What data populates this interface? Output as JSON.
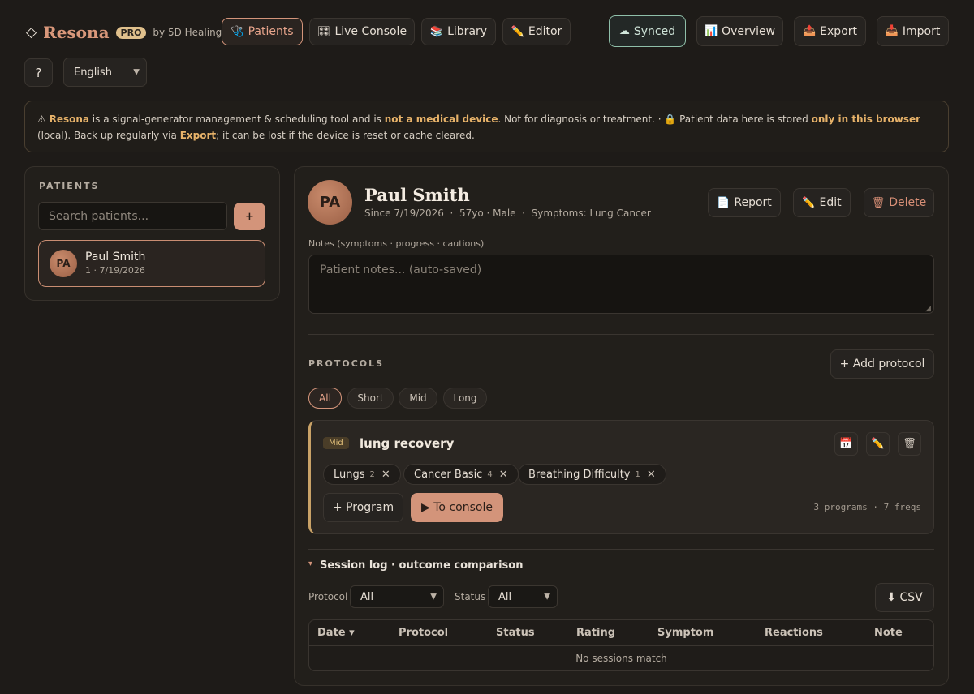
{
  "header": {
    "brand_mark": "◇",
    "brand_name": "Resona",
    "pro": "PRO",
    "by": "by 5D Healing",
    "tabs": [
      {
        "icon": "🩺",
        "label": "Patients"
      },
      {
        "icon": "🎛",
        "label": "Live Console"
      },
      {
        "icon": "📚",
        "label": "Library"
      },
      {
        "icon": "✏️",
        "label": "Editor"
      }
    ],
    "actions": [
      {
        "icon": "☁",
        "label": "Synced"
      },
      {
        "icon": "📊",
        "label": "Overview"
      },
      {
        "icon": "📤",
        "label": "Export"
      },
      {
        "icon": "📥",
        "label": "Import"
      }
    ],
    "help": "?",
    "language": "English"
  },
  "notice": {
    "p1": "⚠ ",
    "b1": "Resona",
    "p2": " is a signal-generator management & scheduling tool and is ",
    "b2": "not a medical device",
    "p3": ". Not for diagnosis or treatment. · 🔒 Patient data here is stored ",
    "b3": "only in this browser",
    "p4": " (local). Back up regularly via ",
    "b4": "Export",
    "p5": "; it can be lost if the device is reset or cache cleared."
  },
  "sidebar": {
    "title": "PATIENTS",
    "search_placeholder": "Search patients...",
    "add": "+",
    "patients": [
      {
        "initials": "PA",
        "name": "Paul Smith",
        "meta": "1 · 7/19/2026"
      }
    ]
  },
  "patient": {
    "initials": "PA",
    "name": "Paul Smith",
    "meta": "Since 7/19/2026  ·  57yo · Male  ·  Symptoms: Lung Cancer",
    "report": "Report",
    "report_icon": "📄",
    "edit": "Edit",
    "edit_icon": "✏️",
    "delete": "Delete",
    "delete_icon": "🗑",
    "notes_label": "Notes (symptoms · progress · cautions)",
    "notes_placeholder": "Patient notes... (auto-saved)"
  },
  "protocols": {
    "title": "PROTOCOLS",
    "add": "+ Add protocol",
    "filters": [
      "All",
      "Short",
      "Mid",
      "Long"
    ],
    "active_filter": "All",
    "items": [
      {
        "badge": "Mid",
        "name": "lung recovery",
        "tags": [
          {
            "label": "Lungs",
            "count": "2"
          },
          {
            "label": "Cancer Basic",
            "count": "4"
          },
          {
            "label": "Breathing Difficulty",
            "count": "1"
          }
        ],
        "add_program": "+ Program",
        "to_console": "▶ To console",
        "summary": "3 programs · 7 freqs",
        "icons": {
          "calendar": "📅",
          "edit": "✏️",
          "delete": "🗑"
        }
      }
    ]
  },
  "session_log": {
    "title": "Session log · outcome comparison",
    "caret": "▾",
    "protocol_label": "Protocol",
    "protocol_value": "All",
    "status_label": "Status",
    "status_value": "All",
    "csv": "⬇ CSV",
    "columns": [
      "Date ▾",
      "Protocol",
      "Status",
      "Rating",
      "Symptom",
      "Reactions",
      "Note"
    ],
    "empty": "No sessions match"
  },
  "colors": {
    "accent": "#d9977a",
    "highlight": "#e8b36a",
    "synced": "#8fbfa9",
    "mid_bar": "#c9a267"
  }
}
